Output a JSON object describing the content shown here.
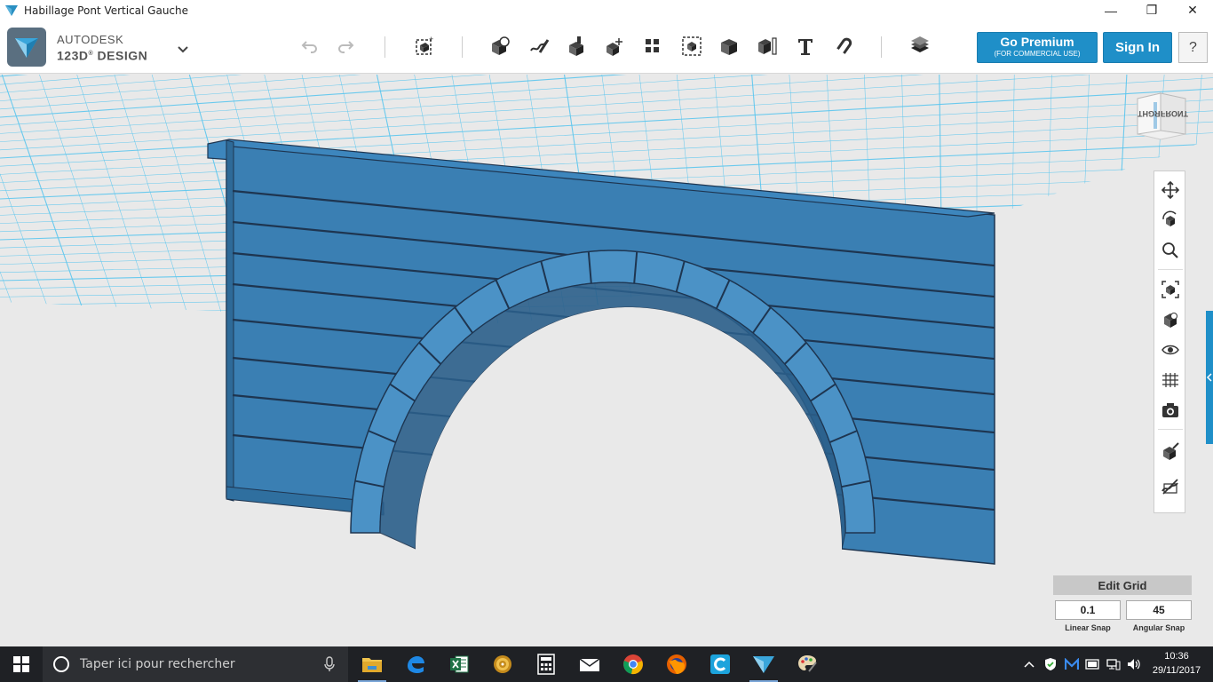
{
  "window": {
    "title": "Habillage Pont Vertical Gauche",
    "controls": [
      "—",
      "❐",
      "✕"
    ]
  },
  "brand": {
    "line1": "AUTODESK",
    "line2": "123D",
    "line2b": "DESIGN"
  },
  "toolbar": {
    "premium_label": "Go Premium",
    "premium_sub": "(FOR COMMERCIAL USE)",
    "signin_label": "Sign In",
    "help_label": "?"
  },
  "viewcube": {
    "face_label": "FRONT",
    "side_label": "RGHT"
  },
  "edit_grid": {
    "title": "Edit Grid",
    "linear_snap_value": "0.1",
    "angular_snap_value": "45",
    "linear_label": "Linear Snap",
    "angular_label": "Angular Snap"
  },
  "taskbar": {
    "search_placeholder": "Taper ici pour rechercher",
    "time": "10:36",
    "date": "29/11/2017"
  },
  "colors": {
    "accent": "#1f8fc8",
    "model": "#3a7fb3",
    "grid": "#5cc6ee"
  }
}
